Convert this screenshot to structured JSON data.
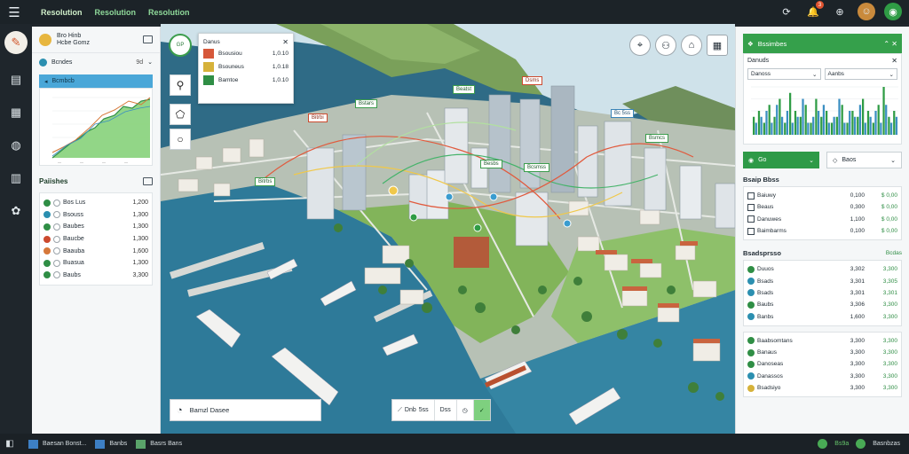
{
  "topbar": {
    "menu_icon": "hamburger-icon",
    "tabs": [
      "Resolution",
      "Resolution",
      "Resolution"
    ],
    "notifications_count": "3",
    "icons": [
      "sync-icon",
      "bell-icon",
      "share-icon",
      "user-avatar",
      "brand-logo"
    ]
  },
  "rail": {
    "items": [
      "logo",
      "document-icon",
      "report-icon",
      "globe-icon",
      "layers-icon",
      "settings-icon"
    ]
  },
  "left_panel": {
    "title_line1": "Bro Hinb",
    "title_line2": "Hcbe Gomz",
    "filter_label": "Bcndes",
    "filter_value": "9d",
    "chart_header": "Bcmbcb",
    "section_title": "Paiishes",
    "list": [
      {
        "label": "Bos Lus",
        "value": "1,200",
        "color": "#2f8e45"
      },
      {
        "label": "Bsouss",
        "value": "1,300",
        "color": "#2b8fb0"
      },
      {
        "label": "Baubes",
        "value": "1,300",
        "color": "#2f8e45"
      },
      {
        "label": "Baucbe",
        "value": "1,300",
        "color": "#cc4a2e"
      },
      {
        "label": "Baauba",
        "value": "1,600",
        "color": "#d6783a"
      },
      {
        "label": "Buasua",
        "value": "1,300",
        "color": "#2f8e45"
      },
      {
        "label": "Baubs",
        "value": "3,300",
        "color": "#2f8e45"
      }
    ]
  },
  "map_card": {
    "title": "Danus",
    "rows": [
      {
        "label": "Bsousiou",
        "value": "1,0.10",
        "color": "#d6583a"
      },
      {
        "label": "Bsouneus",
        "value": "1,0.18",
        "color": "#d6b23a"
      },
      {
        "label": "Bamtoe",
        "value": "1,0.10",
        "color": "#2f8e45"
      }
    ]
  },
  "map": {
    "fab_label": "GP",
    "tools": [
      "lasso-icon",
      "polygon-icon",
      "circle-icon"
    ],
    "round_buttons": [
      "location-pin-icon",
      "search-person-icon",
      "home-icon",
      "grid-icon"
    ],
    "labels": [
      "Bitrbi",
      "Bstars",
      "Beatst",
      "Dsms",
      "Bc 5ss",
      "Bsmcs",
      "Besbs",
      "Bcsmss",
      "Bitrbs"
    ],
    "search_label": "Bamzl Dasee",
    "bottom_tools": [
      "Dnb",
      "5ss",
      "Dss"
    ]
  },
  "right_panel": {
    "header_title": "Bssimbes",
    "card_subtitle": "Danuds",
    "select1": "Danoss",
    "select2": "Aanbs",
    "chart_data": {
      "type": "bar",
      "series": [
        {
          "values": [
            3,
            4,
            2,
            5,
            3,
            6,
            2,
            7,
            4,
            3,
            5,
            2,
            6,
            3,
            4,
            2,
            3,
            5,
            2,
            4,
            3,
            6,
            4,
            2,
            5,
            8,
            3,
            4
          ]
        },
        {
          "values": [
            2,
            3,
            4,
            2,
            5,
            3,
            4,
            2,
            3,
            6,
            2,
            3,
            4,
            5,
            2,
            3,
            6,
            2,
            4,
            3,
            5,
            2,
            3,
            4,
            2,
            5,
            2,
            3
          ]
        }
      ],
      "colors": [
        "#2f9c45",
        "#3b8fc2"
      ]
    },
    "toolbar_btn1": "Go",
    "toolbar_btn2": "Baos",
    "section1_title": "Bsaip Bbss",
    "table1": [
      {
        "name": "Baiuwy",
        "v1": "0,100",
        "v2": "$ 0,00"
      },
      {
        "name": "Beaus",
        "v1": "0,300",
        "v2": "$ 0,00"
      },
      {
        "name": "Danuwes",
        "v1": "1,100",
        "v2": "$ 0,00"
      },
      {
        "name": "Baimbarms",
        "v1": "0,100",
        "v2": "$ 0,00"
      }
    ],
    "section2_title": "Bsadsprsso",
    "section2_link": "Bcdas",
    "table2": [
      {
        "name": "Duuos",
        "v1": "3,302",
        "v2": "3,300",
        "color": "#2f8e45"
      },
      {
        "name": "Bsads",
        "v1": "3,301",
        "v2": "3,305",
        "color": "#2b8fb0"
      },
      {
        "name": "Bsads",
        "v1": "3,301",
        "v2": "3,301",
        "color": "#2b8fb0"
      },
      {
        "name": "Baubs",
        "v1": "3,306",
        "v2": "3,300",
        "color": "#2f8e45"
      },
      {
        "name": "Banbs",
        "v1": "1,600",
        "v2": "3,300",
        "color": "#2b8fb0"
      }
    ],
    "table3": [
      {
        "name": "Baabsomtans",
        "v1": "3,300",
        "v2": "3,300",
        "color": "#2f8e45"
      },
      {
        "name": "Banaus",
        "v1": "3,300",
        "v2": "3,300",
        "color": "#2f8e45"
      },
      {
        "name": "Danoseas",
        "v1": "3,300",
        "v2": "3,300",
        "color": "#2f8e45"
      },
      {
        "name": "Danassos",
        "v1": "3,300",
        "v2": "3,300",
        "color": "#2b8fb0"
      },
      {
        "name": "Bsadsiyo",
        "v1": "3,300",
        "v2": "3,300",
        "color": "#d6b23a"
      }
    ]
  },
  "statusbar": {
    "tasks": [
      "Baesan Bonst...",
      "Banbs",
      "Basrs Bans"
    ],
    "right_text1": "Bs9a",
    "right_text2": "Basnbzas"
  }
}
